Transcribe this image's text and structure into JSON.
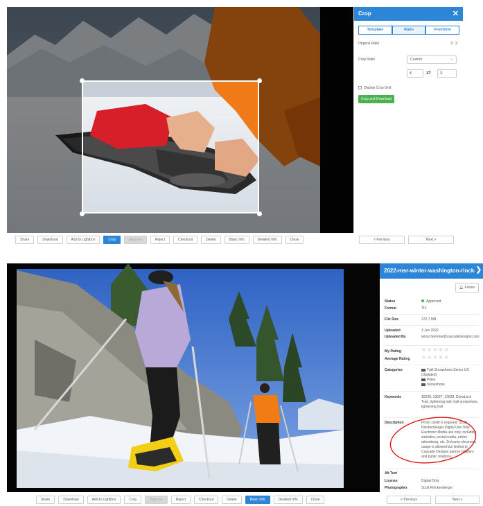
{
  "crop_screen": {
    "panel_title": "Crop",
    "tabs": [
      "Template",
      "Ratio",
      "Freeform"
    ],
    "active_tab": "Ratio",
    "original_ratio_label": "Original Ratio",
    "original_ratio_value": "3 : 2",
    "crop_ratio_label": "Crop Ratio",
    "crop_ratio_select": "Custom",
    "ratio_width": "4",
    "ratio_height": "3",
    "display_grid_label": "Display Crop Grid",
    "crop_download_label": "Crop and Download",
    "prev_label": "< Previous",
    "next_label": "Next >",
    "toolbar": [
      "Share",
      "Download",
      "Add to Lightbox",
      "Crop",
      "Approve",
      "Reject",
      "Checkout",
      "Delete",
      "Basic Info",
      "Detailed Info",
      "Close"
    ]
  },
  "info_screen": {
    "title": "2022-msr-winter-washington-rincke...",
    "follow_label": "Follow",
    "status_label": "Status",
    "status_value": "Approved",
    "format_label": "Format",
    "format_value": "TIF",
    "filesize_label": "File Size",
    "filesize_value": "272.7 MB",
    "uploaded_label": "Uploaded",
    "uploaded_value": "3 Jun 2022",
    "uploadedby_label": "Uploaded By",
    "uploadedby_value": "lance.hemmer@cascadedesigns.com",
    "myrating_label": "My Rating",
    "avgrating_label": "Average Rating",
    "stars": "★★★★★",
    "categories_label": "Categories",
    "categories": [
      "Trail Snowshoes Series US (Updated)",
      "Poles",
      "Snowshoes"
    ],
    "keywords_label": "Keywords",
    "keywords_value": "10239, 13627, 13628, DynaLock Trail, tightening trail, trail snowshoes, tightening trail",
    "description_label": "Description",
    "description_value": "Photo credit is required: Scott Rinckenberger Digital Use Only: Electronic Media use only, including websites, social media, online advertising, etc. 3rd party electronic usage is allowed but limited to Cascade Designs partner retailers and public relations.",
    "alttext_label": "Alt Text",
    "license_label": "License",
    "license_value": "Digital Only",
    "photographer_label": "Photographer",
    "photographer_value": "Scott Rinckenberger",
    "prev_label": "< Previous",
    "next_label": "Next >",
    "toolbar": [
      "Share",
      "Download",
      "Add to Lightbox",
      "Crop",
      "Approve",
      "Reject",
      "Checkout",
      "Delete",
      "Basic Info",
      "Detailed Info",
      "Close"
    ]
  },
  "colors": {
    "accent": "#2c85d6",
    "approve_green": "#4caf50",
    "annotation_red": "#e01010"
  }
}
